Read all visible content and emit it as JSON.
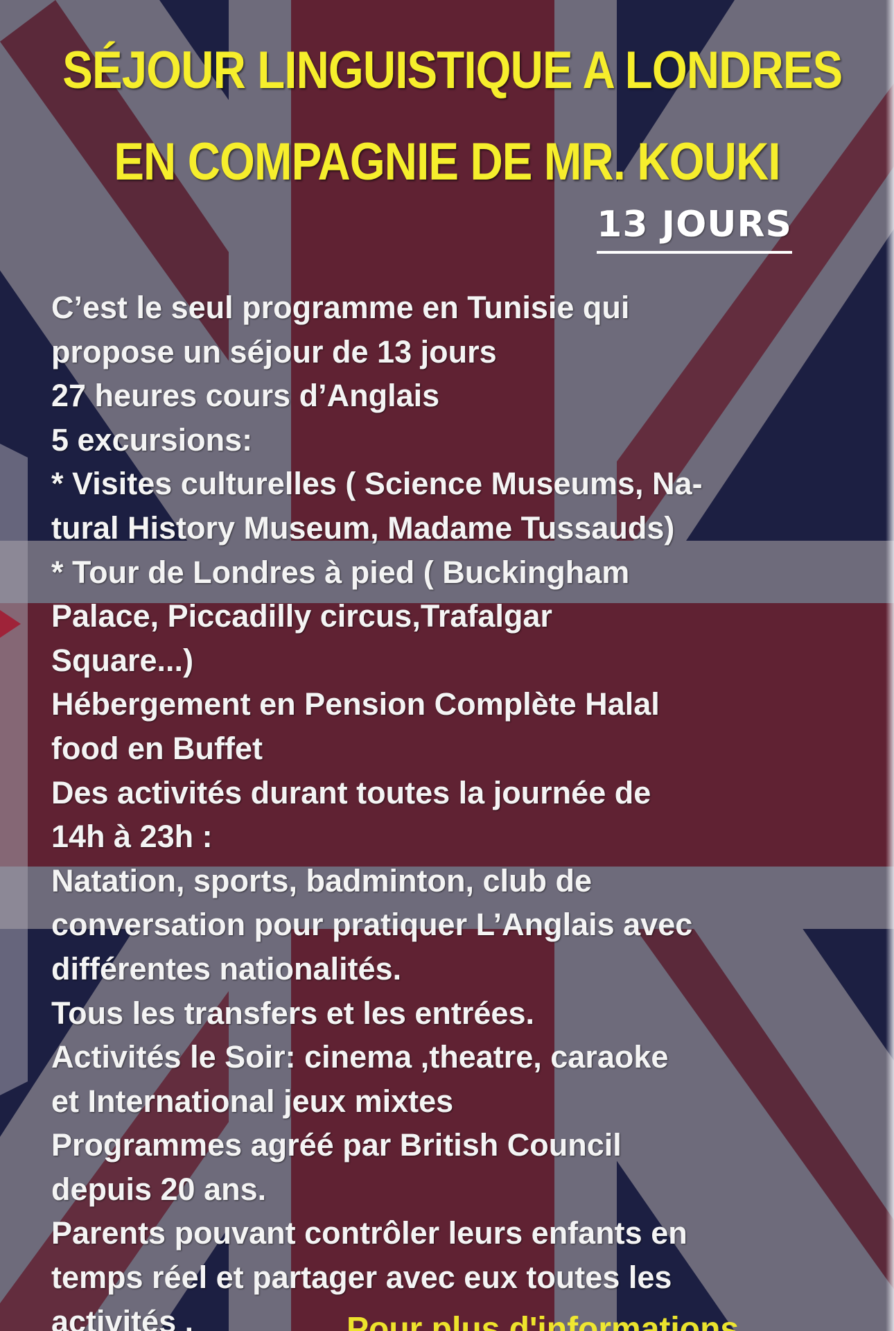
{
  "poster": {
    "title_line1": "SÉJOUR LINGUISTIQUE A LONDRES",
    "title_line2": "EN COMPAGNIE DE MR. KOUKI",
    "duration": "13 JOURS",
    "lines": [
      "C’est le seul programme en Tunisie qui",
      "propose un séjour de 13 jours",
      "27 heures cours d’Anglais",
      "5 excursions:",
      "* Visites culturelles ( Science Museums, Na-",
      "tural History Museum, Madame Tussauds)",
      "* Tour de Londres à pied ( Buckingham",
      "Palace, Piccadilly circus,Trafalgar",
      "Square...)",
      "Hébergement en Pension Complète Halal",
      "food en Buffet",
      "Des activités durant toutes la journée de",
      "14h à 23h :",
      "Natation, sports, badminton, club de",
      "conversation pour pratiquer L’Anglais avec",
      "différentes nationalités.",
      "Tous les transfers et les entrées.",
      "Activités le Soir: cinema ,theatre, caraoke",
      "et International jeux mixtes",
      "Programmes agréé par British Council",
      "depuis 20 ans.",
      "Parents pouvant contrôler leurs enfants en",
      "temps réel et partager avec eux toutes les",
      "activités ."
    ],
    "footer_partial": "Pour plus d'informations"
  },
  "colors": {
    "navy": "#1c2146",
    "red": "#8a2030",
    "grey": "#8e8a95",
    "title_yellow": "#f6ee2c",
    "text_white": "#f4f4f4"
  }
}
